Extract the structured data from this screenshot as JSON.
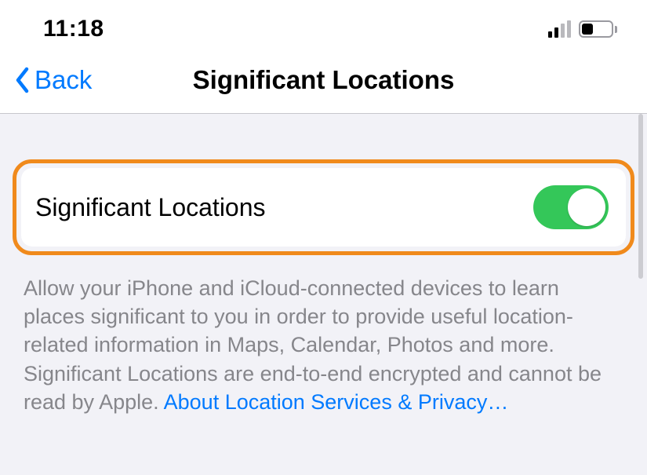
{
  "status": {
    "time": "11:18",
    "cellular_bars_active": 2,
    "cellular_bars_total": 4,
    "battery_percent": 40
  },
  "nav": {
    "back_label": "Back",
    "title": "Significant Locations"
  },
  "row": {
    "label": "Significant Locations",
    "toggle_on": true
  },
  "footer": {
    "text": "Allow your iPhone and iCloud-connected devices to learn places significant to you in order to provide useful location-related information in Maps, Calendar, Photos and more. Significant Locations are end-to-end encrypted and cannot be read by Apple. ",
    "link_text": "About Location Services & Privacy…"
  },
  "colors": {
    "accent": "#007aff",
    "toggle_on_bg": "#34c759",
    "highlight_border": "#f08a1c"
  }
}
